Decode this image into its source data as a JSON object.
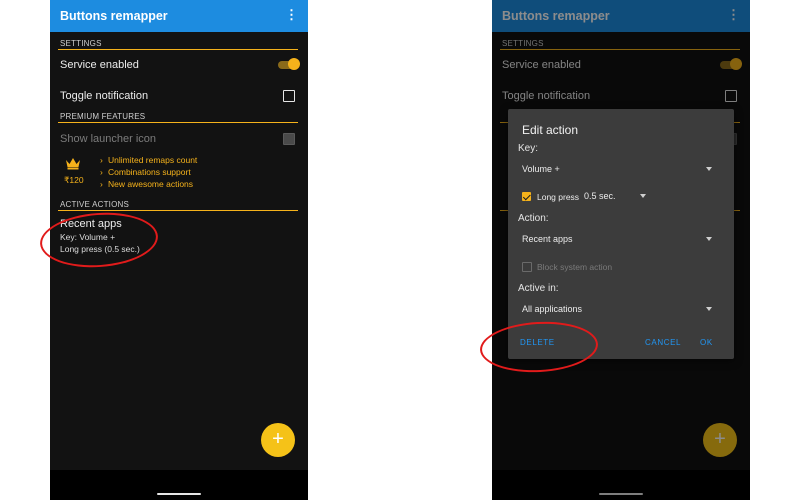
{
  "left": {
    "app_title": "Buttons remapper",
    "menu_icon": "⋮",
    "settings_header": "SETTINGS",
    "service_enabled": "Service enabled",
    "toggle_notification": "Toggle notification",
    "premium_header": "PREMIUM FEATURES",
    "show_launcher_icon": "Show launcher icon",
    "price": "₹120",
    "features": [
      "Unlimited remaps count",
      "Combinations support",
      "New awesome actions"
    ],
    "active_actions_header": "ACTIVE ACTIONS",
    "action_title": "Recent apps",
    "action_key": "Key: Volume +",
    "action_press": "Long press (0.5 sec.)",
    "fab_icon": "+"
  },
  "right": {
    "app_title": "Buttons remapper",
    "menu_icon": "⋮",
    "settings_header": "SETTINGS",
    "service_enabled": "Service enabled",
    "toggle_notification": "Toggle notification",
    "fab_icon": "+",
    "dialog": {
      "title": "Edit action",
      "key_label": "Key:",
      "key_value": "Volume +",
      "long_press_label": "Long press",
      "long_press_value": "0.5 sec.",
      "action_label": "Action:",
      "action_value": "Recent apps",
      "block_system_action": "Block system action",
      "active_in_label": "Active in:",
      "active_in_value": "All applications",
      "delete_btn": "DELETE",
      "cancel_btn": "CANCEL",
      "ok_btn": "OK"
    }
  },
  "colors": {
    "appbar": "#1d8ce0",
    "accent": "#f5b21b",
    "background": "#121212",
    "dialog": "#3c3c3c",
    "button_text": "#2196f3",
    "annotation": "#e11b1b"
  },
  "icons": [
    "overflow-menu-icon",
    "crown-icon",
    "chevron-right-icon",
    "dropdown-arrow-icon",
    "plus-icon",
    "check-icon"
  ]
}
